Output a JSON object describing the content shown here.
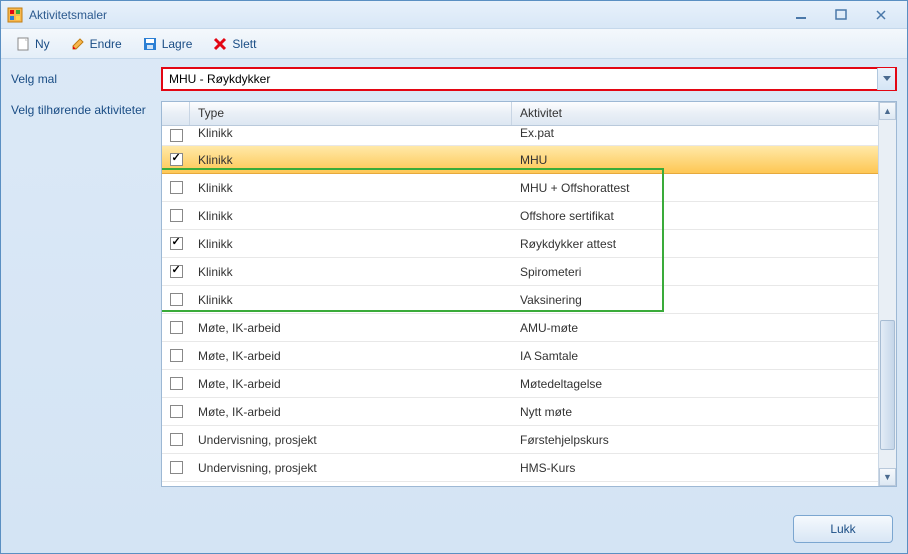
{
  "window": {
    "title": "Aktivitetsmaler"
  },
  "toolbar": {
    "new_label": "Ny",
    "edit_label": "Endre",
    "save_label": "Lagre",
    "delete_label": "Slett"
  },
  "fields": {
    "template_label": "Velg mal",
    "template_value": "MHU - Røykdykker",
    "activities_label": "Velg tilhørende aktiviteter"
  },
  "grid": {
    "header": {
      "type": "Type",
      "activity": "Aktivitet"
    },
    "rows": [
      {
        "checked": false,
        "type": "Klinikk",
        "activity": "Ex.pat",
        "partial": true
      },
      {
        "checked": true,
        "type": "Klinikk",
        "activity": "MHU",
        "selected": true
      },
      {
        "checked": false,
        "type": "Klinikk",
        "activity": "MHU + Offshorattest"
      },
      {
        "checked": false,
        "type": "Klinikk",
        "activity": "Offshore sertifikat"
      },
      {
        "checked": true,
        "type": "Klinikk",
        "activity": "Røykdykker attest"
      },
      {
        "checked": true,
        "type": "Klinikk",
        "activity": "Spirometeri"
      },
      {
        "checked": false,
        "type": "Klinikk",
        "activity": "Vaksinering"
      },
      {
        "checked": false,
        "type": "Møte, IK-arbeid",
        "activity": "AMU-møte"
      },
      {
        "checked": false,
        "type": "Møte, IK-arbeid",
        "activity": "IA Samtale"
      },
      {
        "checked": false,
        "type": "Møte, IK-arbeid",
        "activity": "Møtedeltagelse"
      },
      {
        "checked": false,
        "type": "Møte, IK-arbeid",
        "activity": "Nytt møte"
      },
      {
        "checked": false,
        "type": "Undervisning, prosjekt",
        "activity": "Førstehjelpskurs"
      },
      {
        "checked": false,
        "type": "Undervisning, prosjekt",
        "activity": "HMS-Kurs"
      }
    ]
  },
  "footer": {
    "close_label": "Lukk"
  }
}
